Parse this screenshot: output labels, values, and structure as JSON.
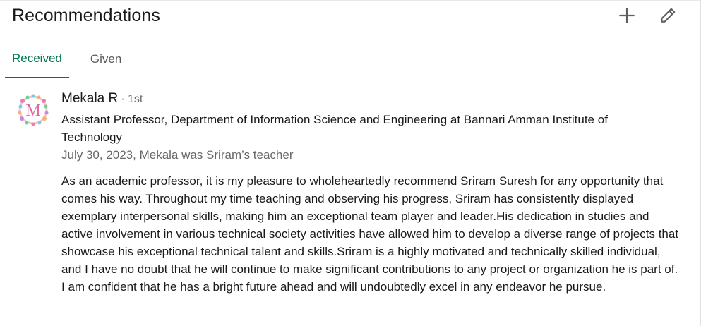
{
  "section": {
    "title": "Recommendations",
    "actions": {
      "add_icon": "plus-icon",
      "edit_icon": "pencil-icon"
    }
  },
  "tabs": [
    {
      "label": "Received",
      "active": true
    },
    {
      "label": "Given",
      "active": false
    }
  ],
  "colors": {
    "accent": "#01754f",
    "text_primary": "#000000e6",
    "text_secondary": "#00000099"
  },
  "recommendation": {
    "name": "Mekala R",
    "degree": "· 1st",
    "avatar_letter": "M",
    "headline": "Assistant Professor, Department of Information Science and Engineering at Bannari Amman Institute of Technology",
    "meta": "July 30, 2023, Mekala was Sriram’s teacher",
    "text": "As an academic professor, it is my pleasure to wholeheartedly recommend Sriram Suresh for any opportunity that comes his way. Throughout my time teaching and observing his progress, Sriram has consistently displayed exemplary interpersonal skills, making him an exceptional team player and leader.His dedication in studies and active involvement in various technical society activities have allowed him to develop a diverse range of projects that showcase his exceptional technical talent and skills.Sriram is a highly motivated and technically skilled individual, and I have no doubt that he will continue to make significant contributions to any project or organization he is part of. I am confident that he has a bright future ahead and will undoubtedly excel in any endeavor he pursue."
  }
}
